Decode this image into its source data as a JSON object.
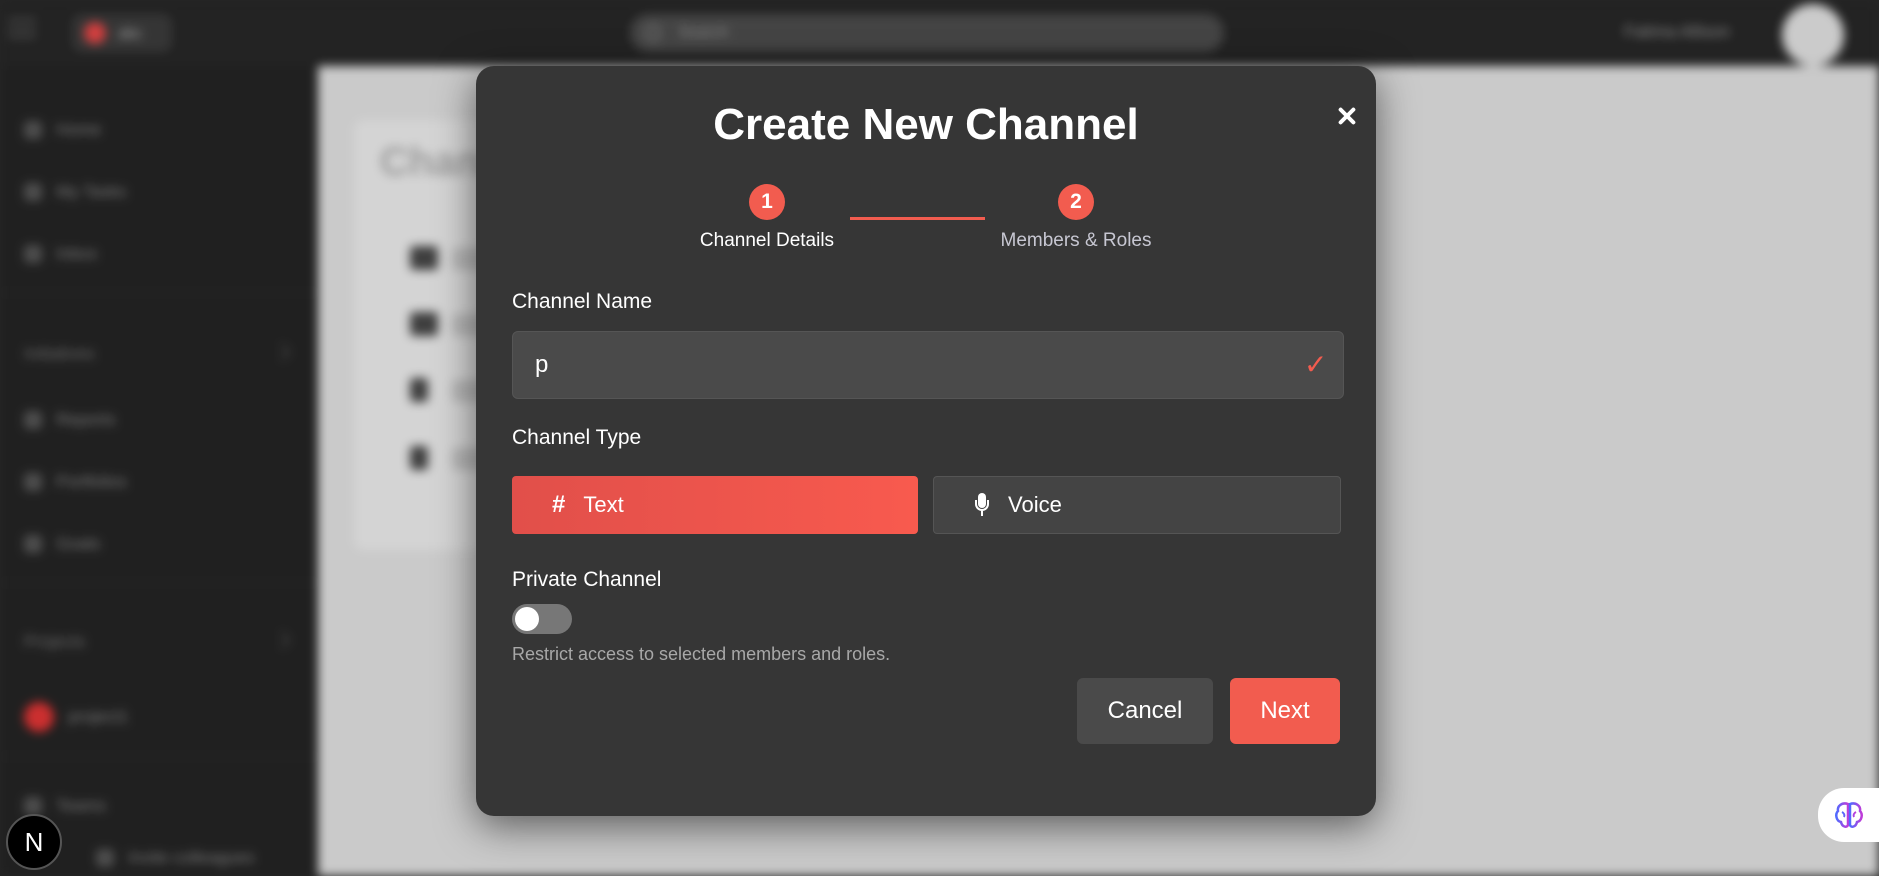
{
  "background": {
    "workspace_name": "abc",
    "search_placeholder": "Search",
    "user_name": "Fatima Allison",
    "sidebar": {
      "nav_items": [
        "Home",
        "My Tasks",
        "Inbox"
      ],
      "initiatives_label": "Initiatives",
      "initiative_items": [
        "Reports",
        "Portfolios",
        "Goals"
      ],
      "projects_label": "Projects",
      "project_item": "project1",
      "teams_label": "Teams",
      "invite_label": "Invite colleagues"
    },
    "main_title": "Chann"
  },
  "modal": {
    "title": "Create New Channel",
    "steps": [
      {
        "number": "1",
        "label": "Channel Details",
        "active": true
      },
      {
        "number": "2",
        "label": "Members & Roles",
        "active": false
      }
    ],
    "channel_name_label": "Channel Name",
    "channel_name_value": "p",
    "valid_icon": "checkmark-icon",
    "channel_type_label": "Channel Type",
    "channel_types": [
      {
        "label": "Text",
        "icon": "hash-icon",
        "selected": true
      },
      {
        "label": "Voice",
        "icon": "microphone-icon",
        "selected": false
      }
    ],
    "private_label": "Private Channel",
    "private_enabled": false,
    "private_help": "Restrict access to selected members and roles.",
    "cancel_label": "Cancel",
    "next_label": "Next"
  },
  "colors": {
    "accent": "#f25c4f",
    "modal_bg": "#363636",
    "input_bg": "#4a4a4a"
  },
  "floating": {
    "dev_logo": "N"
  }
}
